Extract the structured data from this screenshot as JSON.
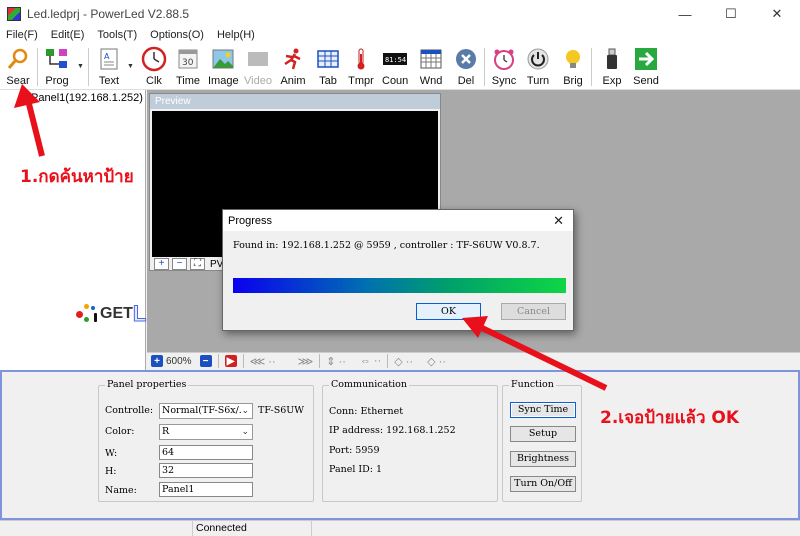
{
  "window": {
    "title": "Led.ledprj - PowerLed V2.88.5",
    "minimize_glyph": "—",
    "maximize_glyph": "☐",
    "close_glyph": "✕"
  },
  "menu": [
    "File(F)",
    "Edit(E)",
    "Tools(T)",
    "Options(O)",
    "Help(H)"
  ],
  "toolbar": {
    "search": "Sear",
    "prog": "Prog",
    "text": "Text",
    "clock": "Clk",
    "time": "Time",
    "image": "Image",
    "video": "Video",
    "anim": "Anim",
    "table": "Tab",
    "temperature": "Tmpr",
    "counter": "Coun",
    "counter_digits": "81:54",
    "calendar_num": "30",
    "window": "Wnd",
    "delete": "Del",
    "sync": "Sync",
    "turn": "Turn",
    "brightness": "Brig",
    "export": "Exp",
    "send": "Send"
  },
  "tree": {
    "panel_label": "Panel1(192.168.1.252)"
  },
  "logo": {
    "part1": "GET",
    "part2": "LED",
    "tm": "TM",
    "colors": [
      "#e02020",
      "#f4a300",
      "#1f5fd0",
      "#2aa02a",
      "#111111"
    ]
  },
  "preview": {
    "title": "Preview",
    "plus": "+",
    "minus": "−",
    "fit": "⛶",
    "label": "PV"
  },
  "zoombar": {
    "zoom": "600%",
    "plus": "+",
    "minus": "−"
  },
  "properties": {
    "panel": {
      "title": "Panel properties",
      "controller_label": "Controlle:",
      "controller_value": "Normal(TF-S6x/.",
      "controller_model": "TF-S6UW",
      "color_label": "Color:",
      "color_value": "R",
      "w_label": "W:",
      "w_value": "64",
      "h_label": "H:",
      "h_value": "32",
      "name_label": "Name:",
      "name_value": "Panel1"
    },
    "communication": {
      "title": "Communication",
      "conn": "Conn: Ethernet",
      "ip": "IP address: 192.168.1.252",
      "port": "Port: 5959",
      "panel_id": "Panel ID: 1"
    },
    "function": {
      "title": "Function",
      "sync_time": "Sync Time",
      "setup": "Setup",
      "brightness": "Brightness",
      "turn_onoff": "Turn On/Off"
    }
  },
  "status": {
    "text": "Connected 192.168.1.252"
  },
  "dialog": {
    "title": "Progress",
    "close": "✕",
    "message": "Found in: 192.168.1.252 @ 5959 , controller : TF-S6UW V0.8.7.",
    "progress": 1.0,
    "ok": "OK",
    "cancel": "Cancel"
  },
  "annotations": {
    "step1": "1.กดค้นหาป้าย",
    "step2": "2.เจอป้ายแล้ว OK",
    "color": "#e8101a"
  }
}
